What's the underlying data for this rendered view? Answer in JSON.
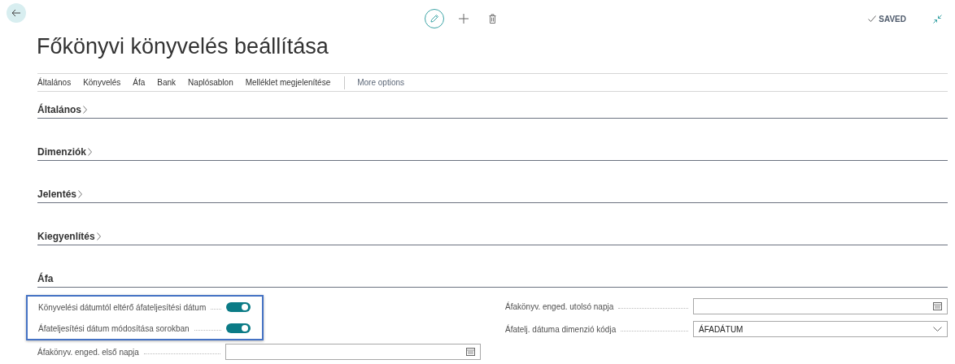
{
  "header": {
    "saved_label": "SAVED"
  },
  "title": "Főkönyvi könyvelés beállítása",
  "nav": {
    "items": [
      {
        "label": "Általános"
      },
      {
        "label": "Könyvelés"
      },
      {
        "label": "Áfa"
      },
      {
        "label": "Bank"
      },
      {
        "label": "Naplósablon"
      },
      {
        "label": "Melléklet megjelenítése"
      }
    ],
    "more": "More options"
  },
  "sections": [
    {
      "title": "Általános",
      "expanded": false
    },
    {
      "title": "Dimenziók",
      "expanded": false
    },
    {
      "title": "Jelentés",
      "expanded": false
    },
    {
      "title": "Kiegyenlítés",
      "expanded": false
    },
    {
      "title": "Áfa",
      "expanded": true,
      "highlighted_fields": [
        {
          "kind": "toggle",
          "label": "Könyvelési dátumtól eltérő áfateljesítési dátum",
          "on": true
        },
        {
          "kind": "toggle",
          "label": "Áfateljesítési dátum módosítása sorokban",
          "on": true
        }
      ],
      "left_fields": [
        {
          "kind": "date",
          "label": "Áfakönyv. enged. első napja"
        }
      ],
      "right_fields": [
        {
          "kind": "date",
          "label": "Áfakönyv. enged. utolsó napja"
        },
        {
          "kind": "select",
          "label": "Áfatelj. dátuma dimenzió kódja",
          "value": "ÁFADÁTUM"
        }
      ]
    }
  ]
}
